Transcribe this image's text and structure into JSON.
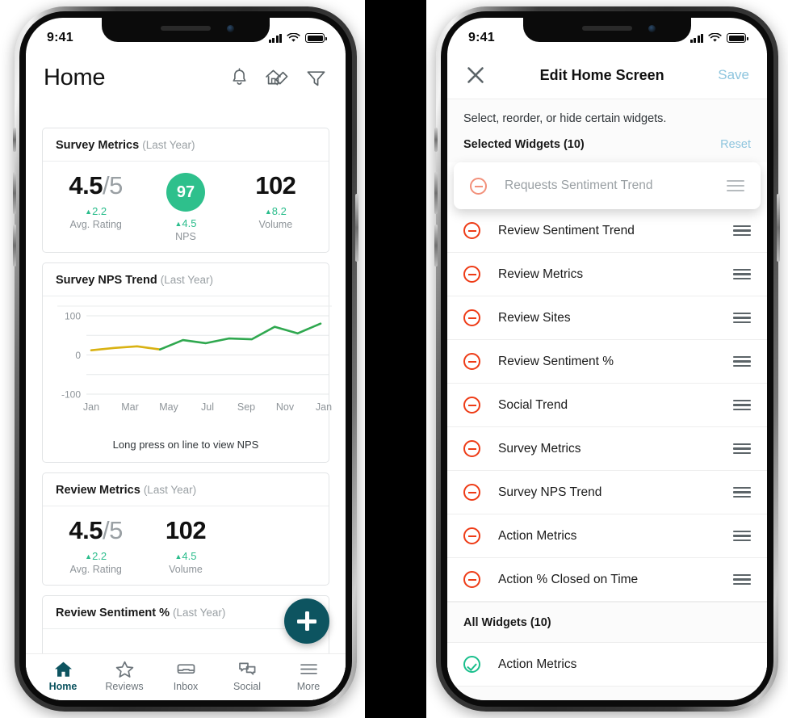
{
  "status_bar": {
    "time": "9:41",
    "signal_icon": "cellular-bars-icon",
    "wifi_icon": "wifi-icon",
    "battery_icon": "battery-icon"
  },
  "left_phone": {
    "header": {
      "title": "Home",
      "icons": [
        {
          "name": "notifications-bell-icon",
          "label": "Notifications"
        },
        {
          "name": "edit-home-icon",
          "label": "Edit Home Screen"
        },
        {
          "name": "filter-funnel-icon",
          "label": "Filter"
        }
      ]
    },
    "cards": [
      {
        "title": "Survey Metrics",
        "period": "(Last Year)",
        "metrics": [
          {
            "value": "4.5",
            "denominator": "/5",
            "delta": "2.2",
            "delta_dir": "up",
            "label": "Avg. Rating",
            "style": "plain"
          },
          {
            "value": "97",
            "denominator": "",
            "delta": "4.5",
            "delta_dir": "up",
            "label": "NPS",
            "style": "circle"
          },
          {
            "value": "102",
            "denominator": "",
            "delta": "8.2",
            "delta_dir": "up",
            "label": "Volume",
            "style": "plain"
          }
        ]
      },
      {
        "title": "Survey NPS Trend",
        "period": "(Last Year)",
        "note": "Long press on line to view NPS"
      },
      {
        "title": "Review Metrics",
        "period": "(Last Year)",
        "metrics": [
          {
            "value": "4.5",
            "denominator": "/5",
            "delta": "2.2",
            "delta_dir": "up",
            "label": "Avg. Rating",
            "style": "plain"
          },
          {
            "value": "102",
            "denominator": "",
            "delta": "4.5",
            "delta_dir": "up",
            "label": "Volume",
            "style": "plain"
          }
        ]
      },
      {
        "title": "Review Sentiment %",
        "period": "(Last Year)"
      }
    ],
    "fab": {
      "name": "add-widget-fab",
      "label": "+"
    },
    "tabbar": [
      {
        "label": "Home",
        "icon": "home-icon",
        "active": true
      },
      {
        "label": "Reviews",
        "icon": "star-icon",
        "active": false
      },
      {
        "label": "Inbox",
        "icon": "inbox-icon",
        "active": false
      },
      {
        "label": "Social",
        "icon": "chat-bubbles-icon",
        "active": false
      },
      {
        "label": "More",
        "icon": "hamburger-menu-icon",
        "active": false
      }
    ]
  },
  "right_phone": {
    "header": {
      "close_icon": "close-x-icon",
      "title": "Edit Home Screen",
      "save_label": "Save"
    },
    "subtitle": "Select, reorder, or hide certain widgets.",
    "selected_section": {
      "label": "Selected Widgets (10)",
      "reset_label": "Reset"
    },
    "selected_widgets": [
      {
        "label": "Requests Sentiment Trend",
        "state": "dragging",
        "icon": "remove-minus-icon",
        "handle": "drag-handle-icon"
      },
      {
        "label": "Review Sentiment Trend",
        "state": "normal",
        "icon": "remove-minus-icon",
        "handle": "drag-handle-icon"
      },
      {
        "label": "Review Metrics",
        "state": "normal",
        "icon": "remove-minus-icon",
        "handle": "drag-handle-icon"
      },
      {
        "label": "Review Sites",
        "state": "normal",
        "icon": "remove-minus-icon",
        "handle": "drag-handle-icon"
      },
      {
        "label": "Review Sentiment %",
        "state": "normal",
        "icon": "remove-minus-icon",
        "handle": "drag-handle-icon"
      },
      {
        "label": "Social Trend",
        "state": "normal",
        "icon": "remove-minus-icon",
        "handle": "drag-handle-icon"
      },
      {
        "label": "Survey Metrics",
        "state": "normal",
        "icon": "remove-minus-icon",
        "handle": "drag-handle-icon"
      },
      {
        "label": "Survey NPS Trend",
        "state": "normal",
        "icon": "remove-minus-icon",
        "handle": "drag-handle-icon"
      },
      {
        "label": "Action Metrics",
        "state": "normal",
        "icon": "remove-minus-icon",
        "handle": "drag-handle-icon"
      },
      {
        "label": "Action % Closed on Time",
        "state": "normal",
        "icon": "remove-minus-icon",
        "handle": "drag-handle-icon"
      }
    ],
    "all_section": {
      "label": "All Widgets (10)"
    },
    "all_widgets": [
      {
        "label": "Action Metrics",
        "icon": "selected-check-icon"
      }
    ]
  },
  "colors": {
    "accent_teal": "#0d5460",
    "accent_green": "#2ec08c",
    "delta_green": "#2bbd8c",
    "remove_red": "#ee3b16",
    "link_blue": "#8ec5de",
    "line_yellow": "#d9b213",
    "line_green": "#2fa84f"
  },
  "chart_data": {
    "type": "line",
    "title": "Survey NPS Trend",
    "subtitle": "(Last Year)",
    "xlabel": "",
    "ylabel": "",
    "ylim": [
      -100,
      100
    ],
    "yticks": [
      -100,
      0,
      100
    ],
    "ytick_labels": [
      "-100",
      "0",
      "100"
    ],
    "gridlines": [
      100,
      50,
      0,
      -50,
      -100
    ],
    "grid": true,
    "legend": "none",
    "xtick_labels": [
      "Jan",
      "Mar",
      "May",
      "Jul",
      "Sep",
      "Nov",
      "Jan"
    ],
    "x": [
      "Jan",
      "Feb",
      "Mar",
      "Apr",
      "May",
      "Jun",
      "Jul",
      "Aug",
      "Sep",
      "Oct",
      "Nov",
      "Dec",
      "Jan"
    ],
    "series": [
      {
        "name": "NPS",
        "values": [
          12,
          15,
          18,
          20,
          22,
          14,
          28,
          38,
          30,
          40,
          44,
          42,
          72,
          85,
          55,
          78
        ],
        "color_low": "#d9b213",
        "color_high": "#2fa84f"
      }
    ],
    "points": [
      {
        "x": "Jan",
        "y": 12
      },
      {
        "x": "Mar",
        "y": 18
      },
      {
        "x": "May",
        "y": 22
      },
      {
        "x": "Jun",
        "y": 14
      },
      {
        "x": "Jul",
        "y": 38
      },
      {
        "x": "Aug",
        "y": 30
      },
      {
        "x": "Sep",
        "y": 42
      },
      {
        "x": "Oct",
        "y": 40
      },
      {
        "x": "Nov",
        "y": 72
      },
      {
        "x": "Dec",
        "y": 55
      },
      {
        "x": "Jan",
        "y": 80
      }
    ],
    "annotation": "Long press on line to view NPS"
  }
}
